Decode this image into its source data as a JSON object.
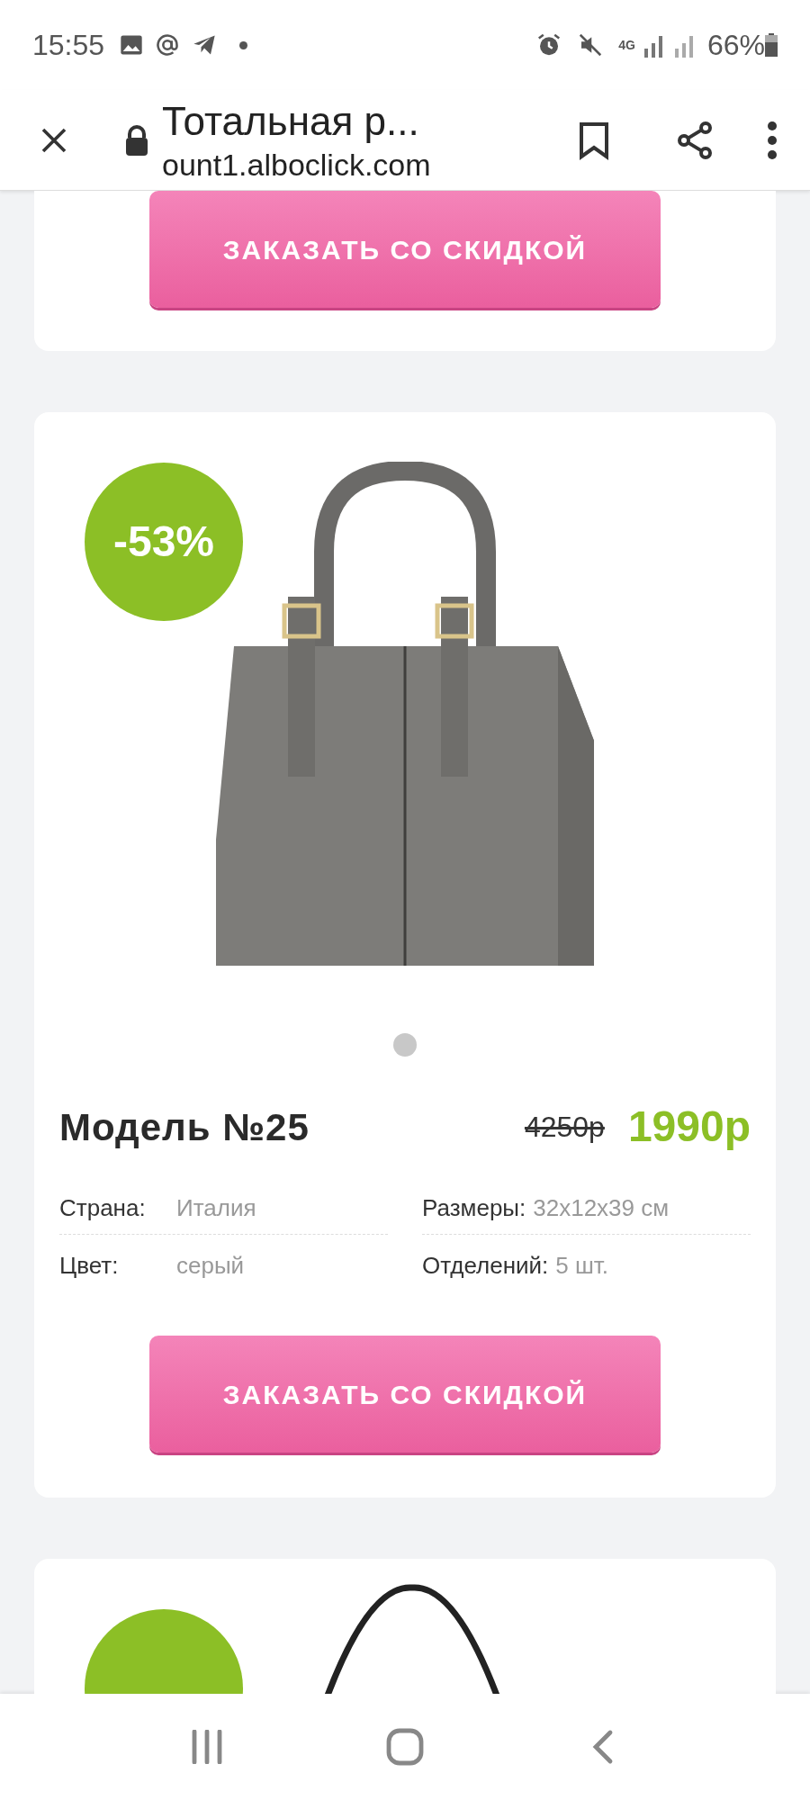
{
  "status_bar": {
    "time": "15:55",
    "battery": "66%",
    "network": "4G"
  },
  "browser_bar": {
    "title": "Тотальная р...",
    "url": "ount1.alboclick.com"
  },
  "top_card": {
    "button": "ЗАКАЗАТЬ СО СКИДКОЙ"
  },
  "product": {
    "discount": "-53%",
    "carousel_dots": [
      {
        "selected": true
      }
    ],
    "name": "Модель №25",
    "old_price": "4250р",
    "price": "1990р",
    "specs": [
      {
        "label": "Страна:",
        "value": "Италия"
      },
      {
        "label": "Размеры:",
        "value": "32x12x39 см"
      },
      {
        "label": "Цвет:",
        "value": "серый"
      },
      {
        "label": "Отделений:",
        "value": "5 шт."
      }
    ],
    "button": "ЗАКАЗАТЬ СО СКИДКОЙ"
  }
}
